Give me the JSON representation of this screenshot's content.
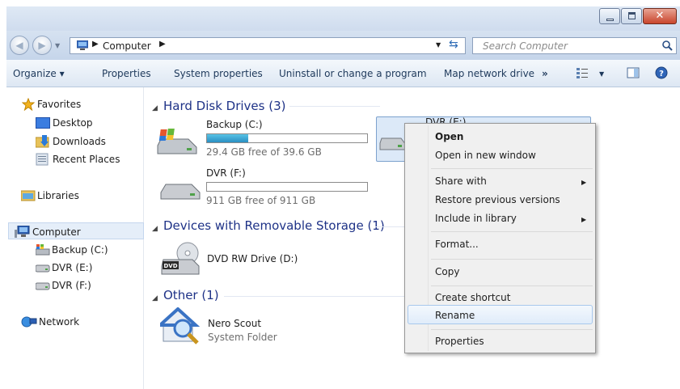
{
  "address": {
    "location": "Computer",
    "search_placeholder": "Search Computer"
  },
  "toolbar": {
    "organize": "Organize ▾",
    "properties": "Properties",
    "system_properties": "System properties",
    "uninstall": "Uninstall or change a program",
    "map_network_drive": "Map network drive",
    "more": "»"
  },
  "nav": {
    "favorites": "Favorites",
    "desktop": "Desktop",
    "downloads": "Downloads",
    "recent_places": "Recent Places",
    "libraries": "Libraries",
    "computer": "Computer",
    "backup_c": "Backup (C:)",
    "dvr_e": "DVR (E:)",
    "dvr_f": "DVR (F:)",
    "network": "Network"
  },
  "groups": {
    "hard_disk": "Hard Disk Drives (3)",
    "removable": "Devices with Removable Storage (1)",
    "other": "Other (1)"
  },
  "drives": [
    {
      "name": "Backup (C:)",
      "free": "29.4 GB free of 39.6 GB",
      "used_fraction": 0.26
    },
    {
      "name": "DVR (F:)",
      "free": "911 GB free of 911 GB",
      "used_fraction": 0.0
    },
    {
      "name": "DVR (E:)"
    }
  ],
  "removable": {
    "name": "DVD RW Drive (D:)",
    "badge": "DVD"
  },
  "other": {
    "name": "Nero Scout",
    "type": "System Folder"
  },
  "context_menu": {
    "open": "Open",
    "open_new_window": "Open in new window",
    "share_with": "Share with",
    "restore_previous": "Restore previous versions",
    "include_library": "Include in library",
    "format": "Format...",
    "copy": "Copy",
    "create_shortcut": "Create shortcut",
    "rename": "Rename",
    "properties": "Properties"
  },
  "colors": {
    "accent_link": "#1e3287",
    "selection": "#dce9f8",
    "capacity_fill": "#2a8fc2"
  }
}
